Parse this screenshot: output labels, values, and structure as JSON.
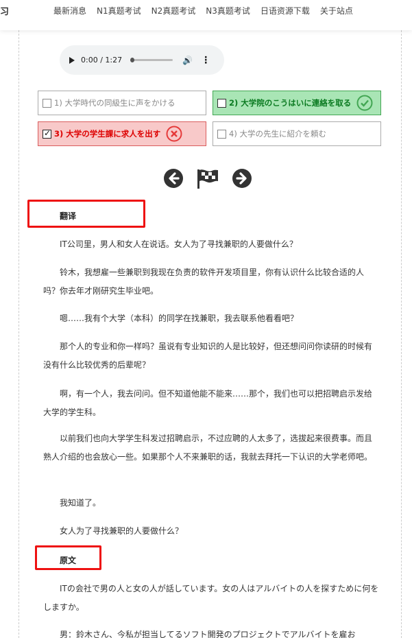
{
  "nav": {
    "logo": "习",
    "items": [
      "最新消息",
      "N1真题考试",
      "N2真题考试",
      "N3真题考试",
      "日语资源下载",
      "关于站点"
    ]
  },
  "audio": {
    "time": "0:00 / 1:27"
  },
  "options": [
    {
      "label": "1) 大学時代の同級生に声をかける",
      "state": "normal"
    },
    {
      "label": "2) 大学院のこうはいに連絡を取る",
      "state": "correct"
    },
    {
      "label": "3) 大学の学生課に求人を出す",
      "state": "wrong"
    },
    {
      "label": "4) 大学の先生に紹介を頼む",
      "state": "normal"
    }
  ],
  "translation": {
    "title": "翻译",
    "paragraphs": [
      "IT公司里，男人和女人在说话。女人为了寻找兼职的人要做什么？",
      "铃木，我想雇一些兼职到我现在负责的软件开发项目里，你有认识什么比较合适的人吗？你去年才刚研究生毕业吧。",
      "嗯……我有个大学（本科）的同学在找兼职，我去联系他看看吧？",
      "那个人的专业和你一样吗？虽说有专业知识的人是比较好，但还想问问你读研的时候有没有什么比较优秀的后辈呢？",
      "啊，有一个人，我去问问。但不知道他能不能来……那个，我们也可以把招聘启示发给大学的学生科。",
      "以前我们也向大学学生科发过招聘启示，不过应聘的人太多了，选拔起来很费事。而且熟人介绍的也会放心一些。如果那个人不来兼职的话，我就去拜托一下认识的大学老师吧。",
      "我知道了。",
      "女人为了寻找兼职的人要做什么？"
    ]
  },
  "original": {
    "title": "原文",
    "paragraphs": [
      "ITの会社で男の人と女の人が話しています。女の人はアルバイトの人を探すために何をしますか。",
      "男：鈴木さん、今私が担当してるソフト開発のプロジェクトでアルバイトを雇お"
    ]
  },
  "colors": {
    "correct": "#43a653",
    "wrong": "#e53a3a",
    "highlight": "#e11111"
  }
}
